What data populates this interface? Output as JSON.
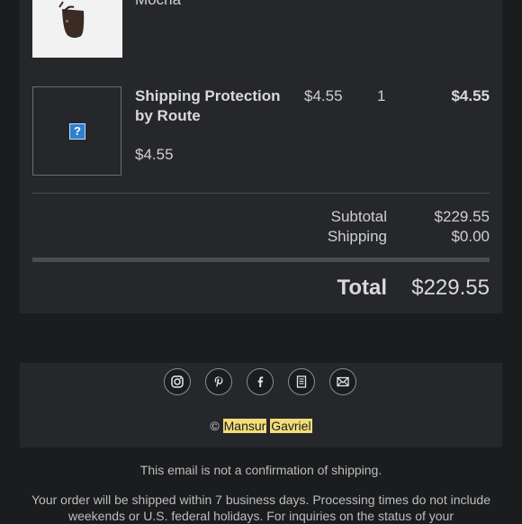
{
  "product_top": {
    "name_partial": "Mocha"
  },
  "item": {
    "placeholder_icon": "?",
    "title": "Shipping Protection by Route",
    "price": "$4.55",
    "unit_price": "$4.55",
    "qty": "1",
    "line_total": "$4.55"
  },
  "summary": {
    "subtotal_label": "Subtotal",
    "subtotal_value": "$229.55",
    "shipping_label": "Shipping",
    "shipping_value": "$0.00",
    "total_label": "Total",
    "total_value": "$229.55"
  },
  "footer": {
    "socials": [
      "instagram-icon",
      "pinterest-icon",
      "facebook-icon",
      "blog-icon",
      "email-icon"
    ],
    "copyright_symbol": "©",
    "brand_word1": "Mansur",
    "brand_word2": "Gavriel"
  },
  "notes": {
    "not_confirmation": "This email is not a confirmation of shipping.",
    "shipping_info": "Your order will be shipped within 7 business days. Processing times do not include weekends or U.S. federal holidays. For inquiries on the status of your"
  },
  "colors": {
    "background": "#1b1c1e",
    "card": "#26272b",
    "highlight": "#f3dd7a"
  }
}
